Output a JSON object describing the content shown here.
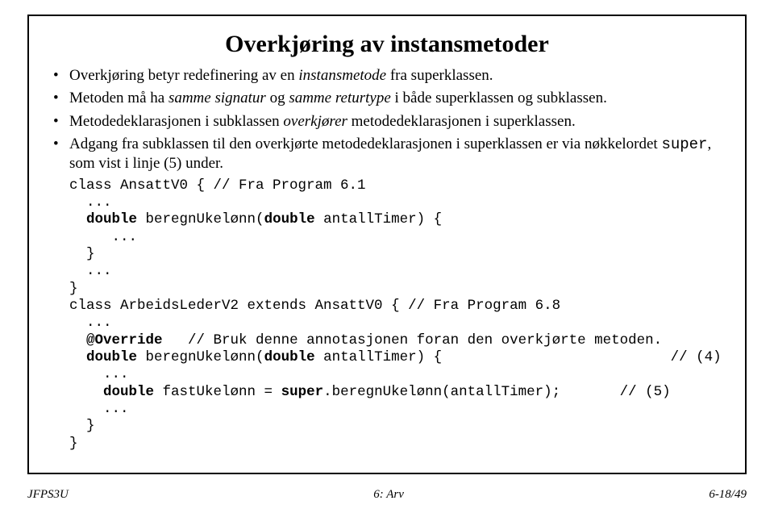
{
  "title": "Overkjøring av instansmetoder",
  "bullets": {
    "b1a": "Overkjøring betyr redefinering av en ",
    "b1i": "instansmetode",
    "b1b": " fra superklassen.",
    "b2a": "Metoden må ha ",
    "b2i1": "samme signatur",
    "b2b": " og ",
    "b2i2": "samme returtype",
    "b2c": " i både superklassen og subklassen.",
    "b3a": "Metodedeklarasjonen i subklassen ",
    "b3i": "overkjører",
    "b3b": " metodedeklarasjonen i superklassen.",
    "b4a": "Adgang fra subklassen til den overkjørte metodedeklarasjonen i superklassen er via nøkkelordet ",
    "b4code": "super",
    "b4b": ", som vist i linje (5) under."
  },
  "code": {
    "l1a": "class AnsattV0 { ",
    "l1b": "// Fra Program 6.1",
    "l2": "  ...",
    "l3a": "  ",
    "l3kw1": "double",
    "l3b": " beregnUkelønn(",
    "l3kw2": "double",
    "l3c": " antallTimer) {",
    "l4": "     ...",
    "l5": "  }",
    "l6": "  ...",
    "l7": "}",
    "l8a": "class ArbeidsLederV2 extends AnsattV0 { ",
    "l8b": "// Fra Program 6.8",
    "l9": "  ...",
    "l10a": "  ",
    "l10kw": "@Override",
    "l10b": "   ",
    "l10c": "// Bruk denne annotasjonen foran den overkjørte metoden.",
    "l11a": "  ",
    "l11kw1": "double",
    "l11b": " beregnUkelønn(",
    "l11kw2": "double",
    "l11c": " antallTimer) {                           ",
    "l11d": "// (4)",
    "l12": "    ...",
    "l13a": "    ",
    "l13kw": "double",
    "l13b": " fastUkelønn = ",
    "l13kw2": "super",
    "l13c": ".beregnUkelønn(antallTimer);       ",
    "l13d": "// (5)",
    "l14": "    ...",
    "l15": "  }",
    "l16": "}"
  },
  "footer": {
    "left": "JFPS3U",
    "center": "6: Arv",
    "right": "6-18/49"
  }
}
